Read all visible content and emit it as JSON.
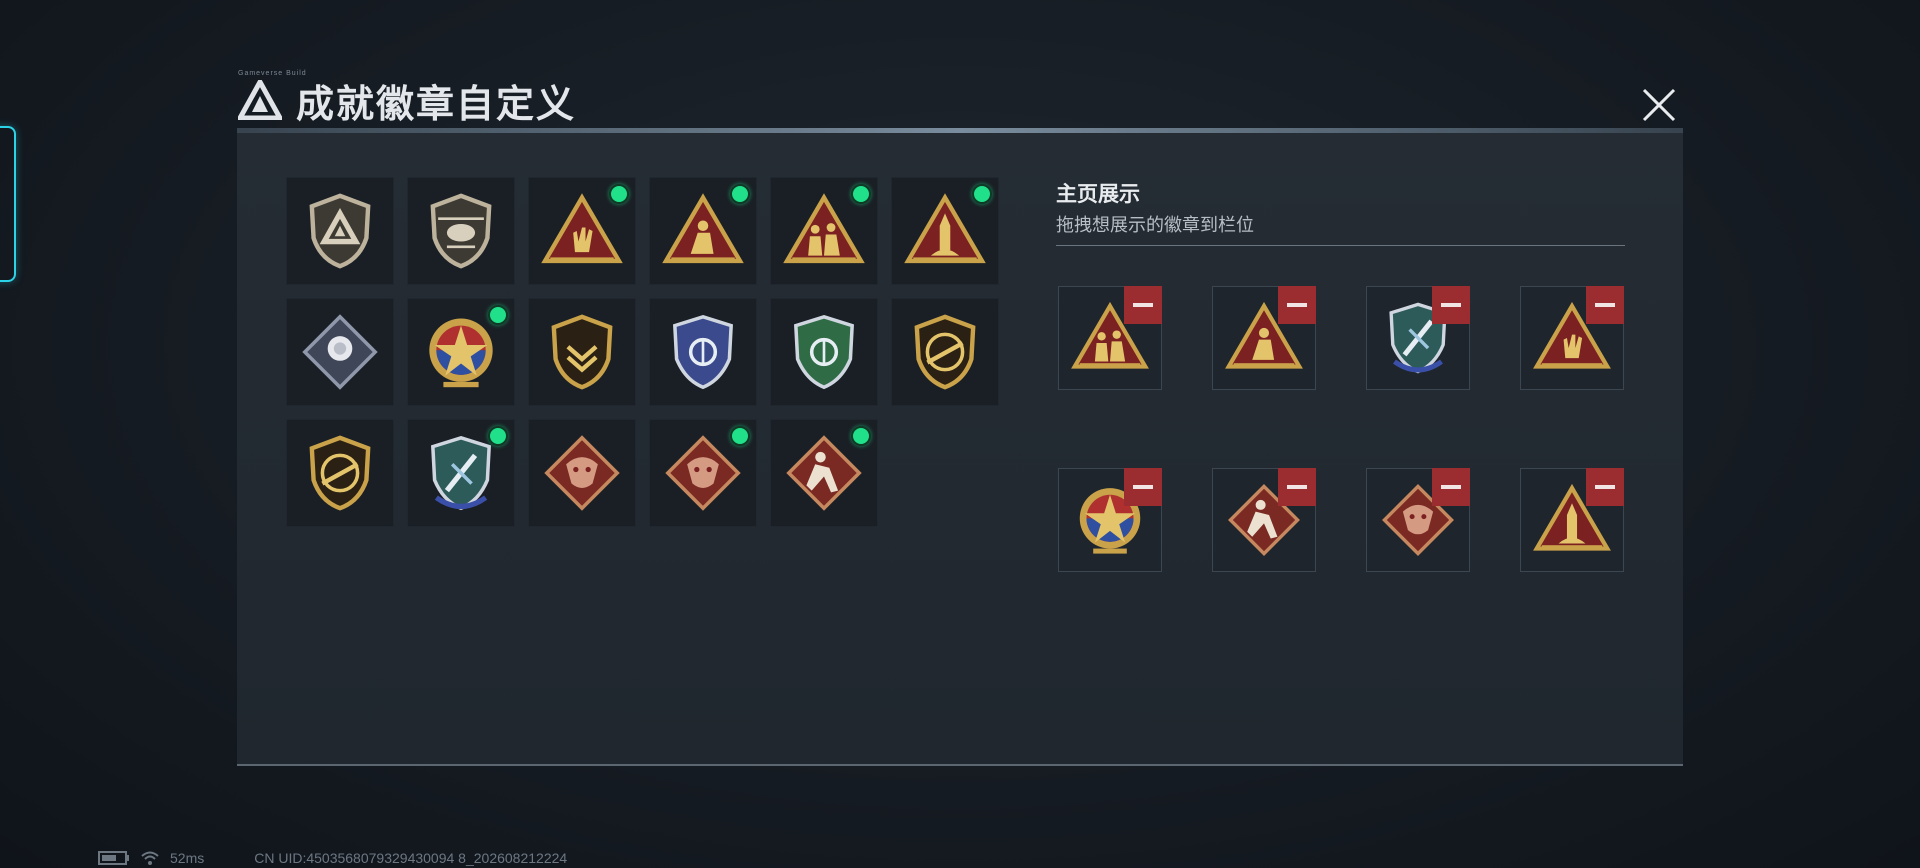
{
  "dialog": {
    "title": "成就徽章自定义",
    "tiny_label": "Gameverse Build"
  },
  "badges": [
    {
      "icon": "triangle-shield-badge",
      "is_new": false
    },
    {
      "icon": "helicopter-shield-badge",
      "is_new": false
    },
    {
      "icon": "rock-hand-triangle-badge",
      "is_new": true
    },
    {
      "icon": "kneeling-soldier-triangle-badge",
      "is_new": true
    },
    {
      "icon": "soldiers-group-triangle-badge",
      "is_new": true
    },
    {
      "icon": "rocket-triangle-badge",
      "is_new": true
    },
    {
      "icon": "rose-diamond-badge",
      "is_new": false
    },
    {
      "icon": "star-roundel-badge",
      "is_new": true
    },
    {
      "icon": "chevron-shield-badge",
      "is_new": false
    },
    {
      "icon": "blue-emblem-badge",
      "is_new": false
    },
    {
      "icon": "green-emblem-badge",
      "is_new": false
    },
    {
      "icon": "rifle-shield-badge",
      "is_new": false
    },
    {
      "icon": "pistol-shield-badge",
      "is_new": false
    },
    {
      "icon": "crossed-blades-shield-badge",
      "is_new": true
    },
    {
      "icon": "dragon-diamond-badge",
      "is_new": false
    },
    {
      "icon": "dragon-diamond-badge",
      "is_new": true
    },
    {
      "icon": "runner-diamond-badge",
      "is_new": true
    }
  ],
  "showcase": {
    "title": "主页展示",
    "subtitle": "拖拽想展示的徽章到栏位",
    "slots": [
      {
        "icon": "soldiers-group-triangle-badge"
      },
      {
        "icon": "kneeling-soldier-triangle-badge"
      },
      {
        "icon": "crossed-blades-shield-badge"
      },
      {
        "icon": "rock-hand-triangle-badge"
      },
      {
        "icon": "star-roundel-badge"
      },
      {
        "icon": "runner-diamond-badge"
      },
      {
        "icon": "dragon-diamond-badge"
      },
      {
        "icon": "rocket-triangle-badge"
      }
    ]
  },
  "status_bar": {
    "ping": "52ms",
    "uid": "CN UID:4503568079329430094 8_202608212224"
  },
  "colors": {
    "accent_cyan": "#2bd3e6",
    "new_dot": "#20e08a",
    "remove_red": "#9b2d31",
    "gold": "#c9a24a"
  }
}
